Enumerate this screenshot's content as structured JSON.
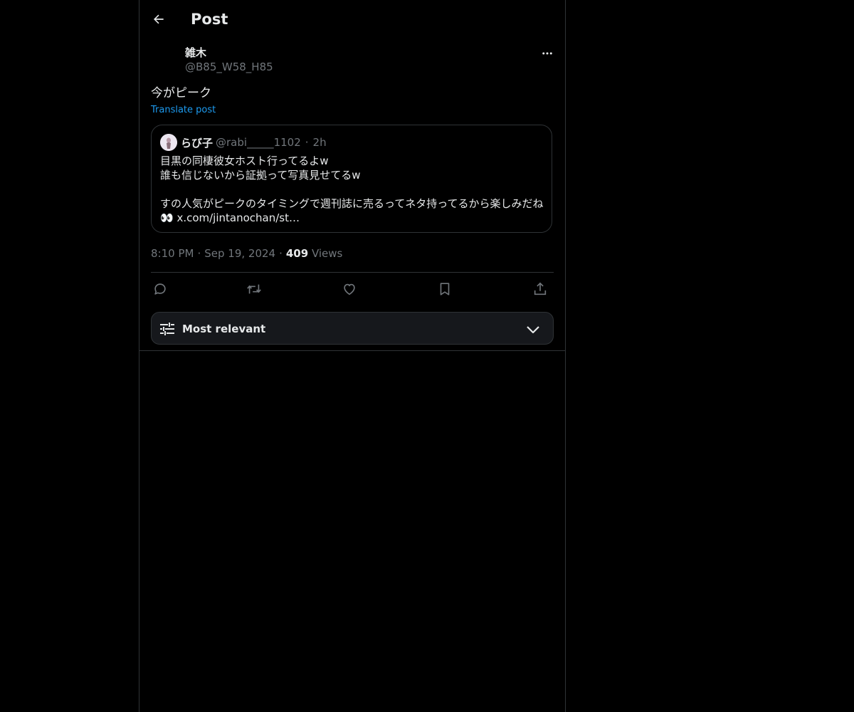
{
  "header": {
    "title": "Post"
  },
  "post": {
    "author_name": "雑木",
    "author_handle": "@B85_W58_H85",
    "text": "今がピーク",
    "translate_label": "Translate post",
    "time": "8:10 PM",
    "date": "Sep 19, 2024",
    "views_count": "409",
    "views_label": "Views"
  },
  "quote": {
    "name": "らび子",
    "handle": "@rabi_____1102",
    "dot": "·",
    "time": "2h",
    "lines": [
      "目黒の同棲彼女ホスト行ってるよw",
      "誰も信じないから証拠って写真見せてるw",
      "",
      "すの人気がピークのタイミングで週刊誌に売るってネタ持ってるから楽しみだね",
      "👀 x.com/jintanochan/st…"
    ]
  },
  "meta": {
    "sep": "·"
  },
  "sort": {
    "label": "Most relevant"
  },
  "icons": {
    "back": "arrow-left-icon",
    "more": "more-horizontal-icon",
    "reply": "reply-icon",
    "repost": "repost-icon",
    "like": "heart-icon",
    "bookmark": "bookmark-icon",
    "share": "share-icon",
    "sort": "sliders-icon",
    "chevron": "chevron-down-icon"
  },
  "colors": {
    "background": "#000000",
    "text": "#e7e9ea",
    "secondary": "#71767b",
    "link": "#1d9bf0",
    "border": "#2f3336",
    "sort_bg": "#16181c"
  }
}
